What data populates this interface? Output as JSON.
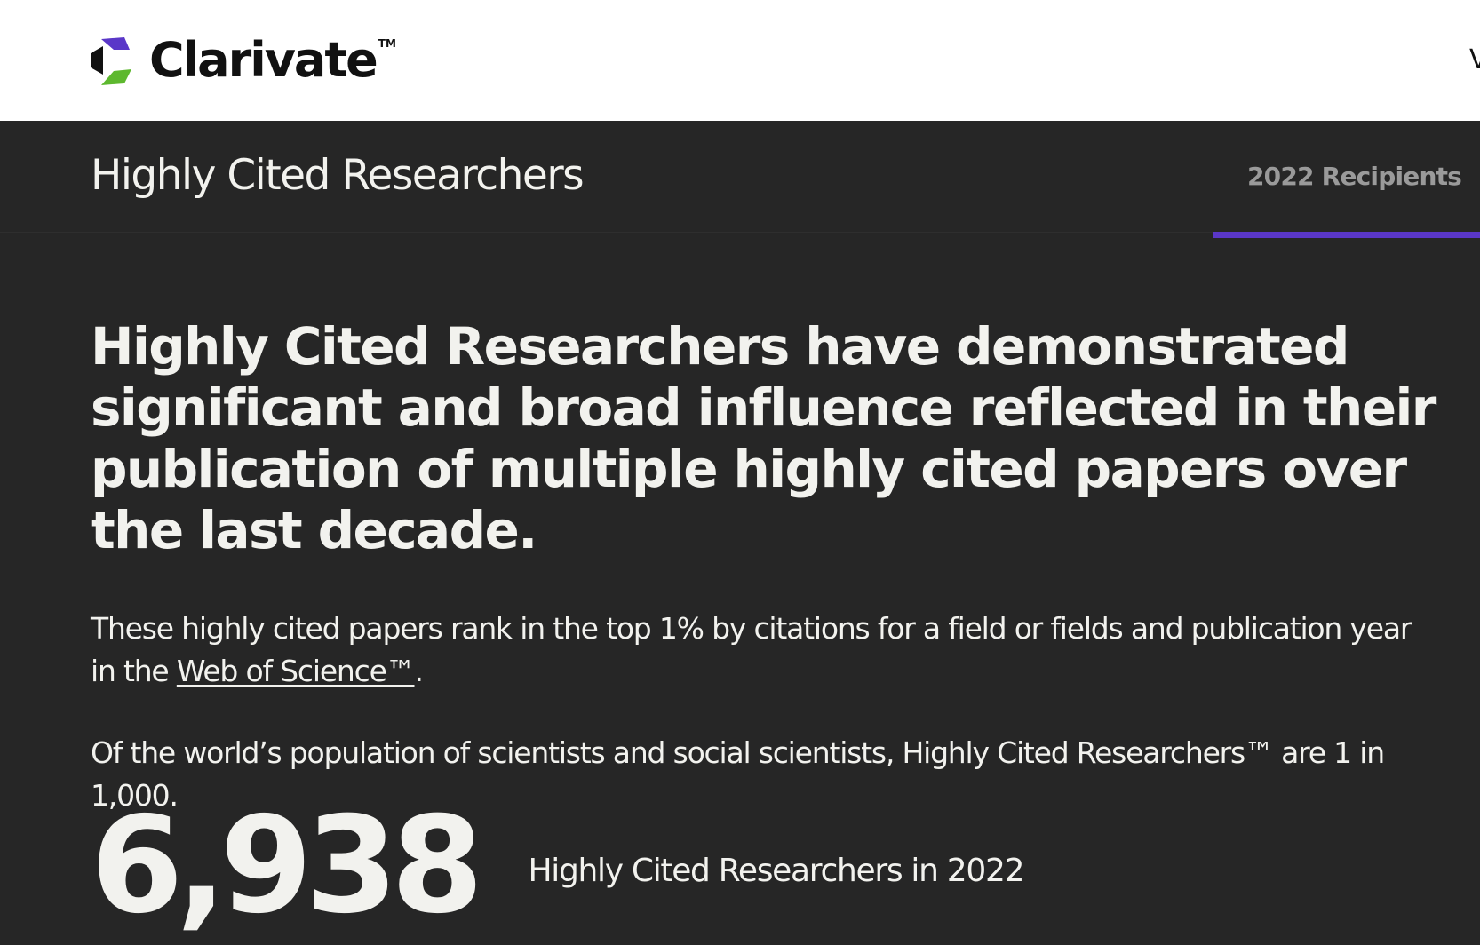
{
  "brand": {
    "name": "Clarivate",
    "trademark": "TM",
    "colors": {
      "purple": "#5a37c8",
      "green": "#5db82e",
      "black": "#111111"
    }
  },
  "header": {
    "edge_glyph": "V"
  },
  "subnav": {
    "title": "Highly Cited Researchers",
    "tab_label": "2022 Recipients",
    "accent_color": "#5a37c8"
  },
  "main": {
    "headline": "Highly Cited Researchers have demonstrated significant and broad influence reflected in their publication of multiple highly cited papers over the last decade.",
    "para1_text": "These highly cited papers rank in the top 1% by citations for a field or fields and publication year in the ",
    "para1_link": "Web of Science™",
    "para1_end": ".",
    "para2_text": "Of the world’s population of scientists and social scientists, Highly Cited Researchers™ are 1 in 1,000."
  },
  "stat": {
    "number": "6,938",
    "label": "Highly Cited Researchers in 2022"
  },
  "icons": {
    "logo": "clarivate-logo-mark"
  }
}
